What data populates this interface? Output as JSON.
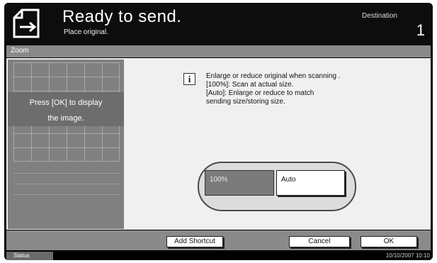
{
  "header": {
    "title": "Ready to send.",
    "subtitle": "Place original.",
    "destination_label": "Destination",
    "destination_count": "1",
    "icon": "send-document-icon"
  },
  "zoom_bar": {
    "label": "Zoom"
  },
  "preview": {
    "message_line1": "Press [OK] to display",
    "message_line2": "the image."
  },
  "info": {
    "icon": "info-icon",
    "glyph": "i",
    "lines": [
      "Enlarge or reduce original when scanning .",
      "[100%]: Scan at actual size.",
      "[Auto]: Enlarge or reduce to match",
      "sending size/storing size."
    ]
  },
  "options": {
    "selected": "100%",
    "items": [
      {
        "label": "100%"
      },
      {
        "label": "Auto"
      }
    ]
  },
  "bottom": {
    "add_shortcut": "Add Shortcut",
    "cancel": "Cancel",
    "ok": "OK"
  },
  "status": {
    "button": "Status",
    "datetime": "10/10/2007  10:10"
  }
}
